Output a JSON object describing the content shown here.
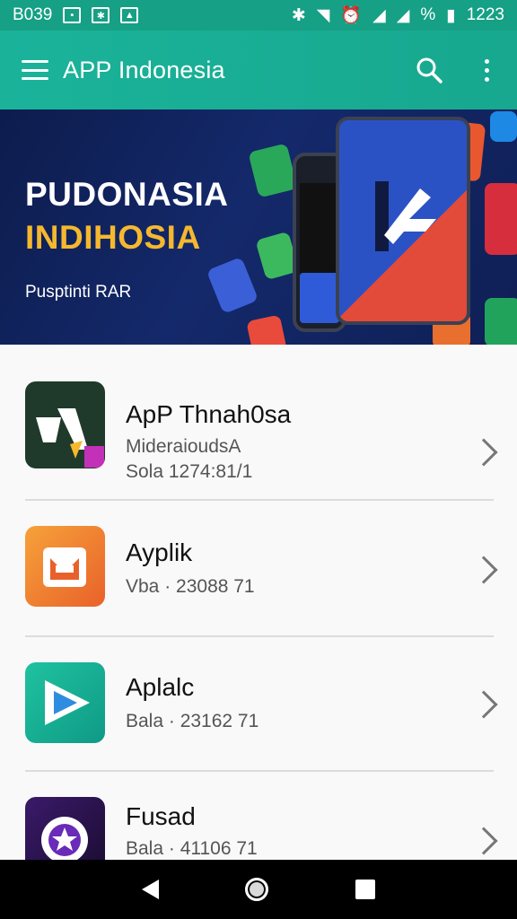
{
  "status_bar": {
    "left_text": "B039",
    "right_percent": "%",
    "time": "1223"
  },
  "app_bar": {
    "title": "APP Indonesia"
  },
  "banner": {
    "line1": "PUDONASIA",
    "line2": "INDIHOSIA",
    "subtitle": "Pusptinti RAR"
  },
  "apps": [
    {
      "title": "ApP Thnah0sa",
      "subtitle1": "MideraioudsA",
      "subtitle2": "Sola 1274:81/1",
      "icon": "app-logo-a-icon",
      "color": "#1f3a2a"
    },
    {
      "title": "Ayplik",
      "subtitle1": "Vba · 23088 71",
      "subtitle2": "",
      "icon": "mail-box-icon",
      "color": "#f07a2a"
    },
    {
      "title": "Aplalc",
      "subtitle1": "Bala · 23162 71",
      "subtitle2": "",
      "icon": "play-arrow-icon",
      "color": "#18b89a"
    },
    {
      "title": "Fusad",
      "subtitle1": "Bala · 41106 71",
      "subtitle2": "",
      "icon": "star-badge-icon",
      "color": "#2a1445"
    }
  ],
  "colors": {
    "accent": "#16a085",
    "banner_dark": "#0f1f55",
    "banner_yellow": "#f5b82e"
  }
}
